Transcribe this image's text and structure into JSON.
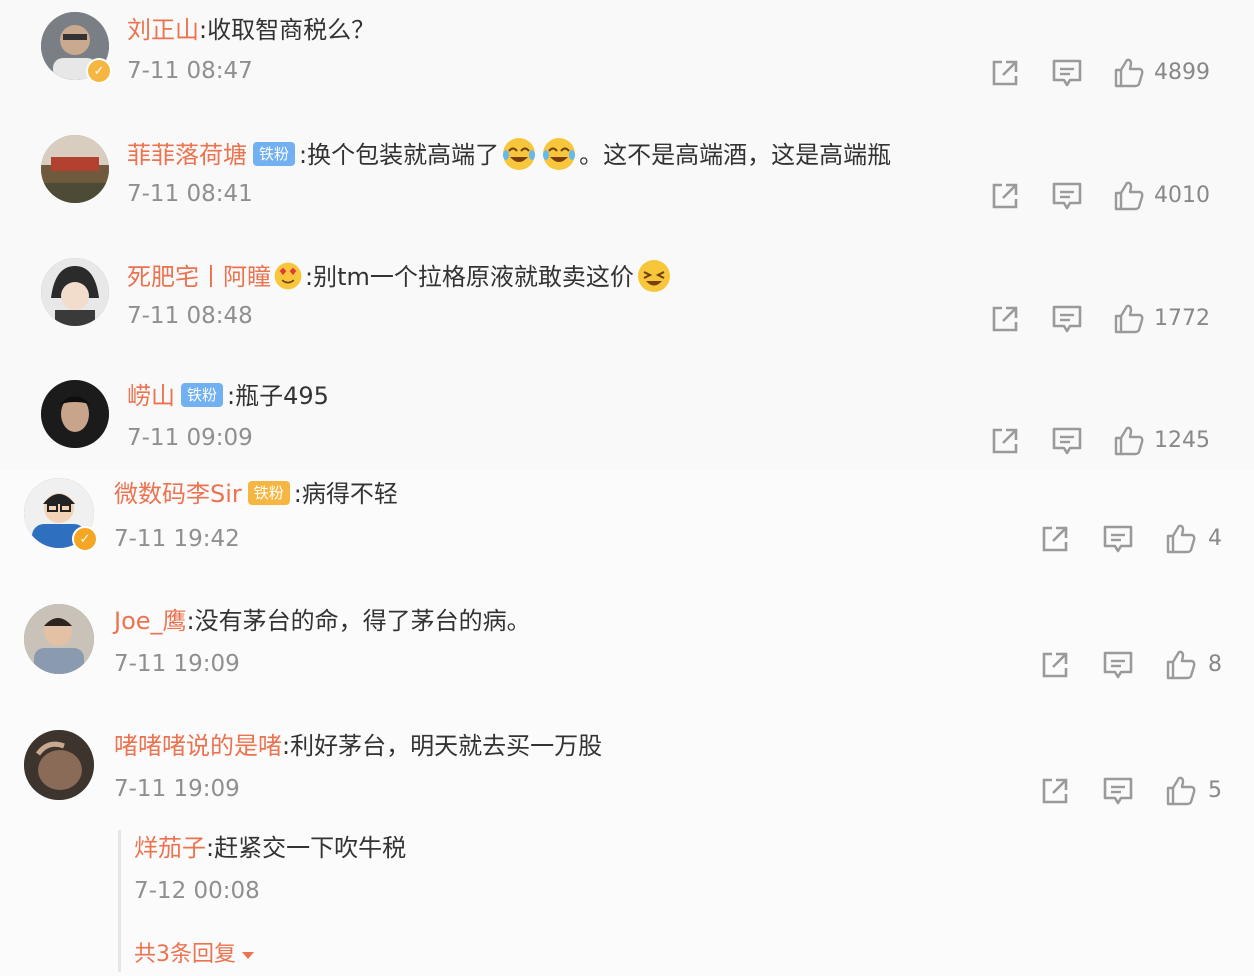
{
  "comments": [
    {
      "username": "刘正山",
      "text": "收取智商税么？",
      "time": "7-11 08:47",
      "likes": "4899",
      "verified": true,
      "verified_color": "#f5b742"
    },
    {
      "username": "菲菲落荷塘",
      "tag": "铁粉",
      "text_a": "换个包装就高端了",
      "text_b": "。这不是高端酒，这是高端瓶",
      "emoji": [
        "grin-tears-icon",
        "grin-tears-icon"
      ],
      "time": "7-11 08:41",
      "likes": "4010"
    },
    {
      "username": "死肥宅丨阿瞳",
      "text": "别tm一个拉格原液就敢卖这价",
      "emoji_before": "heart-eyes-icon",
      "emoji_after": "laughing-icon",
      "time": "7-11 08:48",
      "likes": "1772"
    },
    {
      "username": "崂山",
      "tag": "铁粉",
      "text": "瓶子495",
      "time": "7-11 09:09",
      "likes": "1245"
    },
    {
      "username": "微数码李Sir",
      "tag": "铁粉",
      "text": "病得不轻",
      "time": "7-11 19:42",
      "likes": "4",
      "verified": true,
      "verified_color": "#f5a623"
    },
    {
      "username": "Joe_鹰",
      "text": "没有茅台的命，得了茅台的病。",
      "time": "7-11 19:09",
      "likes": "8"
    },
    {
      "username": "啫啫啫说的是啫",
      "text": "利好茅台，明天就去买一万股",
      "time": "7-11 19:09",
      "likes": "5"
    }
  ],
  "reply": {
    "username": "烊茄子",
    "text": "赶紧交一下吹牛税",
    "time": "7-12 00:08",
    "more_label": "共3条回复"
  },
  "colors": {
    "username": "#eb7350",
    "tag_blue": "#71b1f2",
    "tag_gold": "#f5b742",
    "icon": "#9a9a9a"
  },
  "icons": {
    "share": "share-icon",
    "comment": "comment-icon",
    "like": "thumbs-up-icon"
  }
}
